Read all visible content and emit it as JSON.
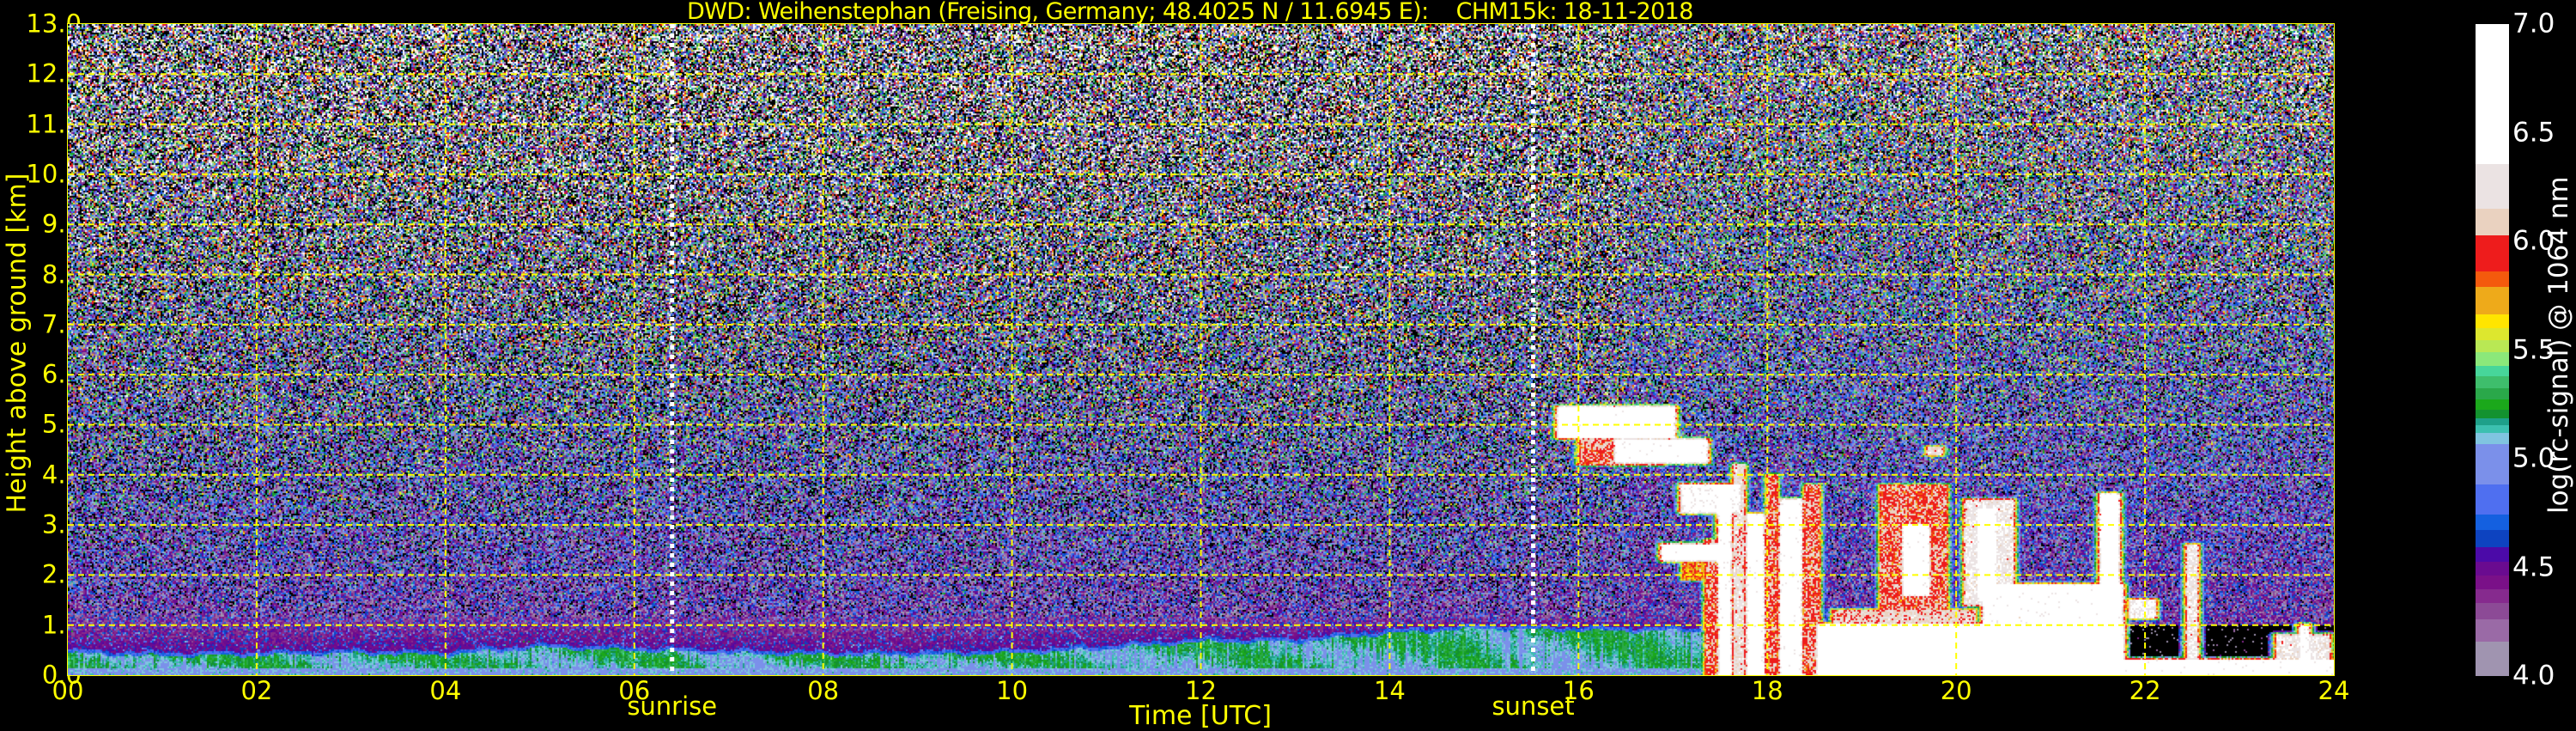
{
  "chart_data": {
    "type": "heatmap",
    "title": "DWD: Weihenstephan (Freising, Germany; 48.4025 N / 11.6945 E):    CHM15k: 18-11-2018",
    "xlabel": "Time [UTC]",
    "ylabel": "Height above ground [km]",
    "xlim": [
      0,
      24
    ],
    "ylim": [
      0,
      13
    ],
    "x_ticks": [
      "00",
      "02",
      "04",
      "06",
      "08",
      "10",
      "12",
      "14",
      "16",
      "18",
      "20",
      "22",
      "24"
    ],
    "x_tick_values": [
      0,
      2,
      4,
      6,
      8,
      10,
      12,
      14,
      16,
      18,
      20,
      22,
      24
    ],
    "y_ticks": [
      "0.0",
      "1.0",
      "2.0",
      "3.0",
      "4.0",
      "5.0",
      "6.0",
      "7.0",
      "8.0",
      "9.0",
      "10.0",
      "11.0",
      "12.0",
      "13.0"
    ],
    "y_tick_values": [
      0,
      1,
      2,
      3,
      4,
      5,
      6,
      7,
      8,
      9,
      10,
      11,
      12,
      13
    ],
    "grid": true,
    "grid_x_values": [
      2,
      4,
      6,
      8,
      10,
      12,
      14,
      16,
      18,
      20,
      22
    ],
    "annotations": [
      {
        "label": "sunrise",
        "time_h": 6.4
      },
      {
        "label": "sunset",
        "time_h": 15.52
      }
    ],
    "colorbar": {
      "label": "log(rc-signal) @ 1064 nm",
      "range": [
        4.0,
        7.0
      ],
      "ticks": [
        "7.0",
        "6.5",
        "6.0",
        "5.5",
        "5.0",
        "4.5",
        "4.0"
      ],
      "tick_values": [
        7.0,
        6.5,
        6.0,
        5.5,
        5.0,
        4.5,
        4.0
      ],
      "levels": [
        4.0,
        4.159,
        4.262,
        4.337,
        4.401,
        4.465,
        4.529,
        4.594,
        4.673,
        4.744,
        4.883,
        5.071,
        5.119,
        5.155,
        5.189,
        5.226,
        5.273,
        5.327,
        5.38,
        5.429,
        5.494,
        5.547,
        5.601,
        5.665,
        5.794,
        5.864,
        6.029,
        6.151,
        6.357,
        7.0
      ],
      "colors": [
        "#a094b0",
        "#9a6aa6",
        "#8c4a96",
        "#862a8e",
        "#7a1088",
        "#6a0b90",
        "#4b0aa8",
        "#0d43c0",
        "#1460e0",
        "#4f6ff0",
        "#7b90ea",
        "#80c4e0",
        "#3cc0b0",
        "#1ea08a",
        "#13922f",
        "#1ba81b",
        "#2aa84a",
        "#3ebe6c",
        "#47d69a",
        "#8be87a",
        "#b9e854",
        "#dde72e",
        "#ffe500",
        "#eeaa1a",
        "#f45a0d",
        "#ee1c1c",
        "#ead2c0",
        "#ebe3e3",
        "#ffffff"
      ]
    },
    "background_profile": {
      "description": "clear-sky signal mean and noise vs height",
      "mean_at_0km": 4.35,
      "mean_slope_per_km": 0.05,
      "noise_at_0km": 0.2,
      "noise_slope_per_km": 0.09
    },
    "boundary_layer_top_km": {
      "time_h": [
        0,
        1,
        2,
        3,
        4,
        5,
        6,
        7,
        8,
        9,
        10,
        11,
        12,
        13,
        14,
        15,
        16,
        17,
        17.5
      ],
      "height_km": [
        0.5,
        0.45,
        0.47,
        0.5,
        0.47,
        0.62,
        0.56,
        0.5,
        0.47,
        0.47,
        0.5,
        0.59,
        0.73,
        0.73,
        0.9,
        1.0,
        0.96,
        0.95,
        0.95
      ]
    },
    "aerosol_layer_top_km": 1.15,
    "cloud_features": [
      {
        "t": [
          15.8,
          17.0
        ],
        "h": [
          4.75,
          5.35
        ],
        "v": 6.7
      },
      {
        "t": [
          16.0,
          16.9
        ],
        "h": [
          4.2,
          4.8
        ],
        "v": 6.0
      },
      {
        "t": [
          16.4,
          17.35
        ],
        "h": [
          4.25,
          4.7
        ],
        "v": 6.6
      },
      {
        "t": [
          17.1,
          17.7
        ],
        "h": [
          3.25,
          3.8
        ],
        "v": 6.5
      },
      {
        "t": [
          16.9,
          17.6
        ],
        "h": [
          2.3,
          2.6
        ],
        "v": 6.7
      },
      {
        "t": [
          17.1,
          17.6
        ],
        "h": [
          1.9,
          2.3
        ],
        "v": 5.8
      },
      {
        "t": [
          17.35,
          17.45
        ],
        "h": [
          0,
          2.7
        ],
        "v": 6.0
      },
      {
        "t": [
          17.5,
          17.6
        ],
        "h": [
          0,
          3.7
        ],
        "v": 6.6
      },
      {
        "t": [
          17.65,
          17.75
        ],
        "h": [
          0,
          4.2
        ],
        "v": 6.2
      },
      {
        "t": [
          17.8,
          17.95
        ],
        "h": [
          0,
          3.2
        ],
        "v": 6.6
      },
      {
        "t": [
          18.0,
          18.1
        ],
        "h": [
          0,
          4.0
        ],
        "v": 6.0
      },
      {
        "t": [
          18.15,
          18.35
        ],
        "h": [
          0,
          3.5
        ],
        "v": 6.6
      },
      {
        "t": [
          18.4,
          18.55
        ],
        "h": [
          0,
          3.8
        ],
        "v": 6.0
      },
      {
        "t": [
          18.55,
          21.75
        ],
        "h": [
          0,
          1.0
        ],
        "v": 6.8
      },
      {
        "t": [
          18.7,
          20.2
        ],
        "h": [
          0,
          1.3
        ],
        "v": 6.1
      },
      {
        "t": [
          20.3,
          21.75
        ],
        "h": [
          0,
          1.8
        ],
        "v": 6.6
      },
      {
        "t": [
          19.2,
          19.9
        ],
        "h": [
          1.0,
          3.8
        ],
        "v": 6.0
      },
      {
        "t": [
          19.45,
          19.7
        ],
        "h": [
          1.6,
          3.0
        ],
        "v": 6.6
      },
      {
        "t": [
          20.1,
          20.6
        ],
        "h": [
          1.4,
          3.5
        ],
        "v": 6.3
      },
      {
        "t": [
          20.25,
          20.4
        ],
        "h": [
          1.5,
          3.3
        ],
        "v": 6.8
      },
      {
        "t": [
          21.55,
          21.7
        ],
        "h": [
          1.5,
          3.6
        ],
        "v": 6.8
      },
      {
        "t": [
          19.7,
          19.85
        ],
        "h": [
          4.4,
          4.55
        ],
        "v": 6.2
      },
      {
        "t": [
          21.75,
          24
        ],
        "h": [
          0,
          0.3
        ],
        "v": 6.6
      },
      {
        "t": [
          22.45,
          22.55
        ],
        "h": [
          0.3,
          2.6
        ],
        "v": 6.3
      },
      {
        "t": [
          21.85,
          22.1
        ],
        "h": [
          1.15,
          1.5
        ],
        "v": 6.4
      },
      {
        "t": [
          23.4,
          23.95
        ],
        "h": [
          0.25,
          0.8
        ],
        "v": 6.3
      },
      {
        "t": [
          23.65,
          23.72
        ],
        "h": [
          0.3,
          1.0
        ],
        "v": 6.5
      }
    ],
    "clear_regions": [
      {
        "t": [
          21.8,
          24
        ],
        "h": [
          0.3,
          1.0
        ],
        "v": 3.5
      }
    ]
  }
}
